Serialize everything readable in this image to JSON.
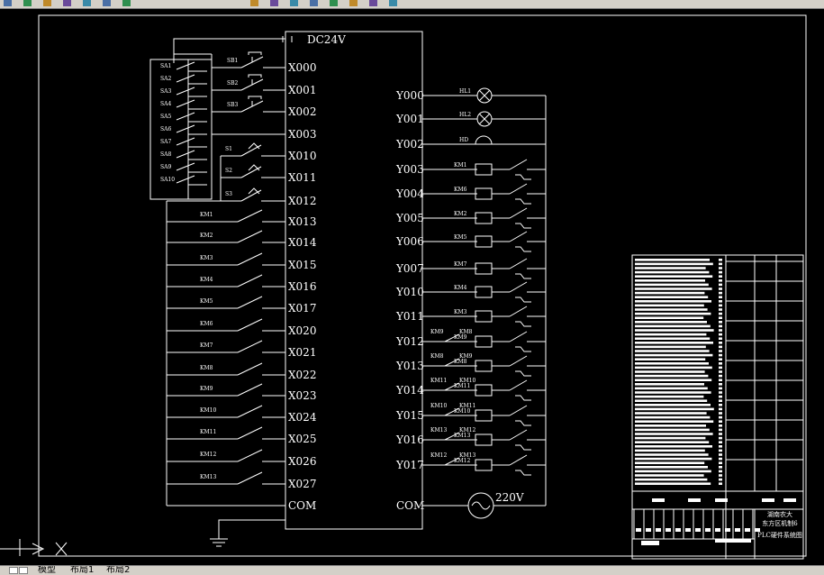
{
  "app": {
    "toolbar_icons": [
      "undo-icon",
      "redo-icon",
      "pan-icon",
      "zoom-icon",
      "zoom-window-icon",
      "zoom-previous-icon",
      "properties-icon",
      "layer-icon",
      "design-center-icon",
      "tool-palette-icon",
      "text-style-icon",
      "dim-style-icon",
      "table-style-icon",
      "plot-style-icon",
      "save-icon"
    ]
  },
  "tabs": {
    "model": "模型",
    "layout1": "布局1",
    "layout2": "布局2"
  },
  "plc": {
    "power_label": "DC24V",
    "inputs": [
      "X000",
      "X001",
      "X002",
      "X003",
      "X010",
      "X011",
      "X012",
      "X013",
      "X014",
      "X015",
      "X016",
      "X017",
      "X020",
      "X021",
      "X022",
      "X023",
      "X024",
      "X025",
      "X026",
      "X027",
      "COM"
    ],
    "outputs": [
      "Y000",
      "Y001",
      "Y002",
      "Y003",
      "Y004",
      "Y005",
      "Y006",
      "Y007",
      "Y010",
      "Y011",
      "Y012",
      "Y013",
      "Y014",
      "Y015",
      "Y016",
      "Y017",
      "COM"
    ],
    "ac_label": "220V"
  },
  "input_contacts": {
    "sb": [
      "SB1",
      "SB2",
      "SB3"
    ],
    "sa": [
      "SA1",
      "SA2",
      "SA3",
      "SA4",
      "SA5",
      "SA6",
      "SA7",
      "SA8",
      "SA9",
      "SA10"
    ],
    "limit": [
      "S1",
      "S2",
      "S3"
    ],
    "km": [
      "KM1",
      "KM2",
      "KM3",
      "KM4",
      "KM5",
      "KM6",
      "KM7",
      "KM8",
      "KM9",
      "KM10",
      "KM11",
      "KM12",
      "KM13"
    ]
  },
  "output_devices": {
    "lamps": [
      "HL1",
      "HL2"
    ],
    "buzzer": "HD",
    "coils": [
      "KM1",
      "KM6",
      "KM2",
      "KM5",
      "KM7",
      "KM4",
      "KM3",
      "KM9",
      "KM8",
      "KM11",
      "KM10",
      "KM13",
      "KM12"
    ],
    "interlocks": {
      "Y012": [
        "KM9",
        "KM8"
      ],
      "Y013": [
        "KM8",
        "KM9"
      ],
      "Y014": [
        "KM11",
        "KM10"
      ],
      "Y015": [
        "KM10",
        "KM11"
      ],
      "Y016": [
        "KM13",
        "KM12"
      ],
      "Y017": [
        "KM12",
        "KM13"
      ]
    }
  },
  "title_block": {
    "school_line1": "湖南农大",
    "school_line2": "东方区机制6",
    "drawing_title": "PLC硬件系统图"
  },
  "colors": {
    "background": "#000000",
    "line": "#ffffff",
    "toolbar": "#d4d0c8"
  }
}
